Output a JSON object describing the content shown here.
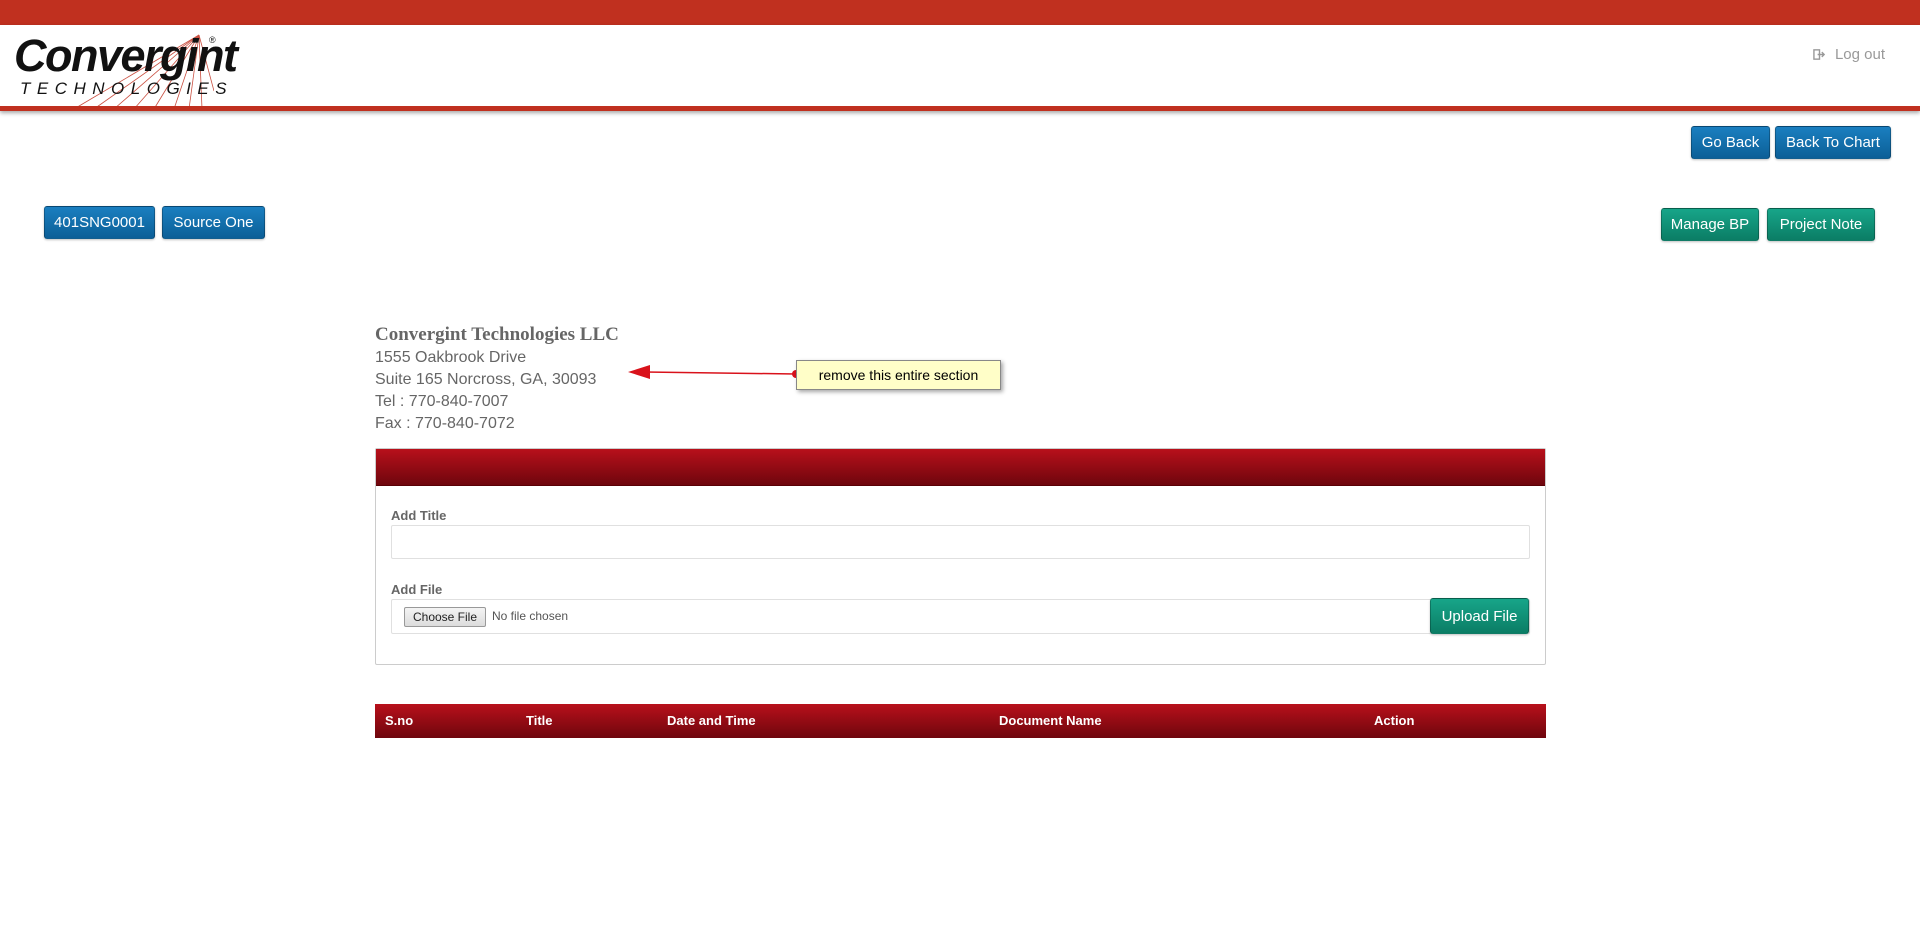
{
  "header": {
    "logo": {
      "word": "Convergint",
      "sub": "TECHNOLOGIES",
      "reg": "®"
    },
    "logout_label": "Log out"
  },
  "nav": {
    "go_back": "Go Back",
    "back_to_chart": "Back To Chart"
  },
  "project": {
    "id_label": "401SNG0001",
    "source_label": "Source One",
    "manage_bp": "Manage BP",
    "project_note": "Project Note"
  },
  "company": {
    "name": "Convergint Technologies LLC",
    "address1": "1555 Oakbrook Drive",
    "address2": "Suite 165 Norcross, GA, 30093",
    "tel": "Tel : 770-840-7007",
    "fax": "Fax : 770-840-7072"
  },
  "annotation": {
    "text": "remove this entire section",
    "color": "#d9121b"
  },
  "upload_form": {
    "title_label": "Add Title",
    "title_value": "",
    "file_label": "Add File",
    "choose_file": "Choose File",
    "no_file": "No file chosen",
    "upload_button": "Upload File"
  },
  "table": {
    "columns": [
      "S.no",
      "Title",
      "Date and Time",
      "Document Name",
      "Action"
    ],
    "rows": []
  },
  "colors": {
    "brand_red": "#c0301f",
    "panel_red": "#a50d17",
    "blue_button": "#1677b8",
    "green_button": "#11967a"
  }
}
